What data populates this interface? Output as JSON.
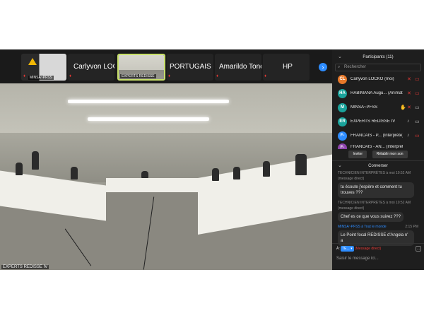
{
  "strip": {
    "tiles": [
      {
        "name": "",
        "caption": "MINSA~PFSS"
      },
      {
        "name": "",
        "caption": "EXPERTS REDISSE"
      },
      {
        "name": "Carlyvon LOC..."
      },
      {
        "name": "PORTUGAIS -..."
      },
      {
        "name": "Amarildo Tonet"
      },
      {
        "name": "HP"
      }
    ],
    "next_icon": "chevron-right-icon"
  },
  "video": {
    "caption": "EXPERTS REDISSE IV"
  },
  "participants": {
    "title": "Participants (11)",
    "search_placeholder": "Rechercher",
    "rows": [
      {
        "initials": "CL",
        "name": "Carlyvon LOCKO (moi)",
        "color": "#e8792a"
      },
      {
        "initials": "HA",
        "name": "HABIMANA Augu... (Animateur)",
        "color": "#1aa39b"
      },
      {
        "initials": "M",
        "name": "MINSA~PFSS",
        "color": "#1aa39b"
      },
      {
        "initials": "ER",
        "name": "EXPERTS REDISSE IV",
        "color": "#1aa39b"
      },
      {
        "initials": "F-",
        "name": "FRANCAIS - P... (Interprète)",
        "color": "#2d8cff"
      },
      {
        "initials": "F-",
        "name": "FRANCAIS - AN... (Interprète)",
        "color": "#8e44ad"
      }
    ],
    "invite_label": "Inviter",
    "unmute_label": "Rétablir mon son"
  },
  "chat": {
    "title": "Converser",
    "messages": [
      {
        "meta": "TECHNICIEN INTERPRÈTES à moi  10:52 AM",
        "sub": "(message direct)",
        "text": "tu écoute j'espère et comment tu trouves ???"
      },
      {
        "meta": "TECHNICIEN INTERPRÈTES à moi  10:52 AM",
        "sub": "(message direct)",
        "text": "Chef es ce que vous suivez ???"
      },
      {
        "meta_from": "MINSA~PFSS",
        "meta_to": "à Tout le monde",
        "meta_time": "2:15 PM",
        "text": "Le Point focal REDISSE d'Angola n' a"
      }
    ],
    "to_label": "À:",
    "to_value": "TE...",
    "to_suffix": "(Message direct)",
    "input_placeholder": "Saisir le message ici..."
  }
}
